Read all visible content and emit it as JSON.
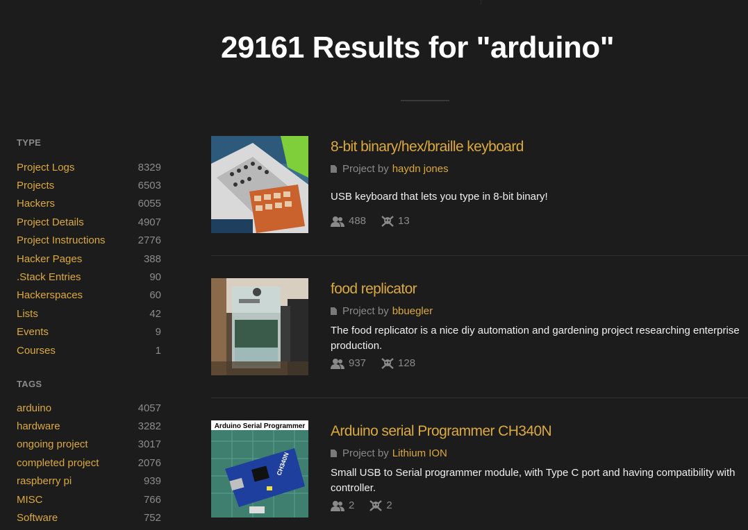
{
  "search": {
    "heading": "29161 Results for \"arduino\""
  },
  "sidebar": {
    "type_heading": "TYPE",
    "type_items": [
      {
        "label": "Project Logs",
        "count": "8329"
      },
      {
        "label": "Projects",
        "count": "6503"
      },
      {
        "label": "Hackers",
        "count": "6055"
      },
      {
        "label": "Project Details",
        "count": "4907"
      },
      {
        "label": "Project Instructions",
        "count": "2776"
      },
      {
        "label": "Hacker Pages",
        "count": "388"
      },
      {
        "label": ".Stack Entries",
        "count": "90"
      },
      {
        "label": "Hackerspaces",
        "count": "60"
      },
      {
        "label": "Lists",
        "count": "42"
      },
      {
        "label": "Events",
        "count": "9"
      },
      {
        "label": "Courses",
        "count": "1"
      }
    ],
    "tags_heading": "TAGS",
    "tag_items": [
      {
        "label": "arduino",
        "count": "4057"
      },
      {
        "label": "hardware",
        "count": "3282"
      },
      {
        "label": "ongoing project",
        "count": "3017"
      },
      {
        "label": "completed project",
        "count": "2076"
      },
      {
        "label": "raspberry pi",
        "count": "939"
      },
      {
        "label": "MISC",
        "count": "766"
      },
      {
        "label": "Software",
        "count": "752"
      }
    ]
  },
  "results": [
    {
      "title": "8-bit binary/hex/braille keyboard",
      "by_prefix": "Project by",
      "author": "haydn jones",
      "description": "USB keyboard that lets you type in 8-bit binary!",
      "followers": "488",
      "skulls": "13"
    },
    {
      "title": "food replicator",
      "by_prefix": "Project by",
      "author": "bbuegler",
      "description": "The food replicator is a nice diy automation and gardening project researching enterprise production.",
      "followers": "937",
      "skulls": "128"
    },
    {
      "title": "Arduino serial Programmer CH340N",
      "by_prefix": "Project by",
      "author": "Lithium ION",
      "description": "Small USB to Serial programmer module, with Type C port and having compatibility with controller.",
      "followers": "2",
      "skulls": "2",
      "thumb_caption": "Arduino Serial Programmer",
      "thumb_chip": "CH340N"
    }
  ],
  "icons": {
    "doc": "document-icon",
    "followers": "followers-icon",
    "skulls": "skull-icon"
  },
  "colors": {
    "background": "#1c1c1c",
    "accent": "#dba93f",
    "muted": "#8a8a8a"
  }
}
